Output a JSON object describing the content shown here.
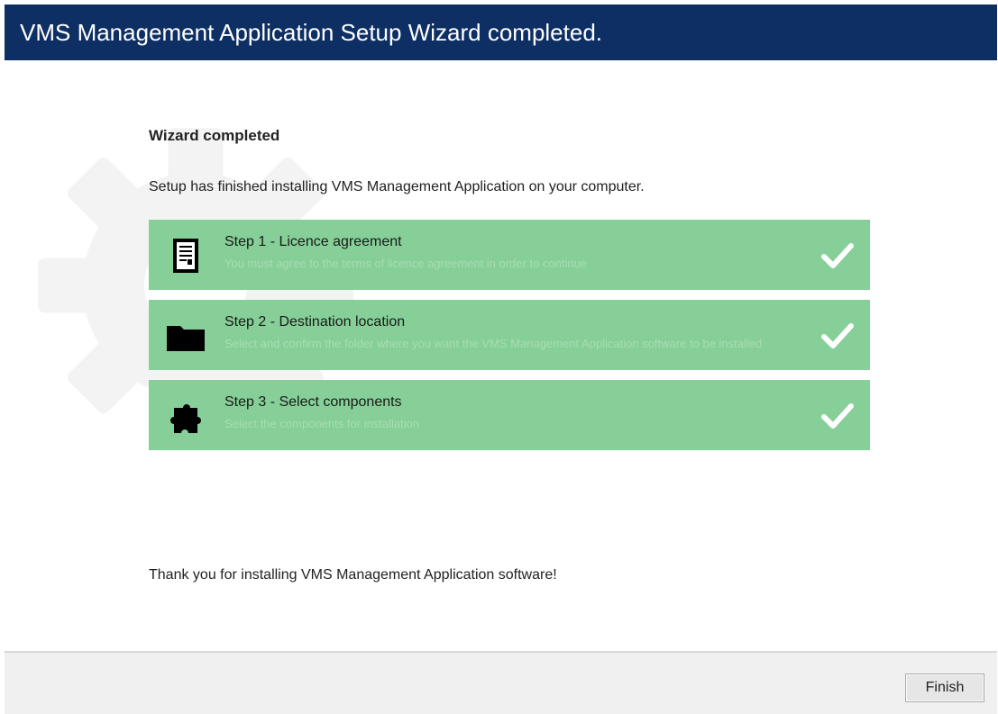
{
  "window": {
    "title": "VMS Management Application Setup Wizard completed."
  },
  "main": {
    "heading": "Wizard completed",
    "subtitle": "Setup has finished installing VMS Management Application on your computer.",
    "steps": [
      {
        "title": "Step 1 - Licence agreement",
        "description": "You must agree to the terms of licence agreement in order to continue",
        "icon": "document-icon",
        "status": "completed"
      },
      {
        "title": "Step 2 - Destination location",
        "description": "Select and confirm the folder where you want the VMS Management Application software to be installed",
        "icon": "folder-icon",
        "status": "completed"
      },
      {
        "title": "Step 3 - Select components",
        "description": "Select the components for installation",
        "icon": "puzzle-icon",
        "status": "completed"
      }
    ],
    "thanks": "Thank you for installing VMS Management Application software!"
  },
  "footer": {
    "finish_label": "Finish"
  },
  "colors": {
    "title_bar": "#0e2f63",
    "step_background": "#86cf98",
    "step_description": "#a9dcb4",
    "footer_background": "#f0f0f0"
  }
}
